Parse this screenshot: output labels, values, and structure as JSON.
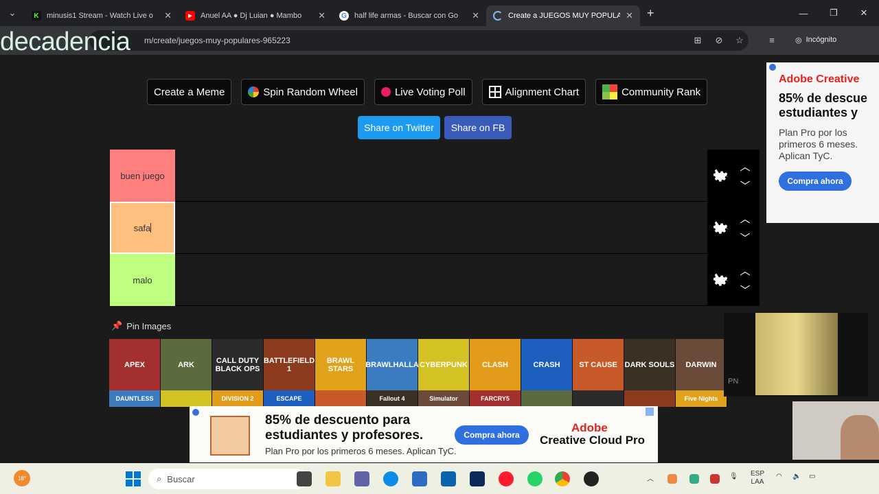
{
  "browser": {
    "tabs": [
      {
        "title": "minusis1 Stream - Watch Live o",
        "favicon": "K",
        "favicon_color": "#53fc18"
      },
      {
        "title": "Anuel AA ● Dj Luian ● Mambo",
        "favicon": "youtube-icon",
        "favicon_color": "#ff0000"
      },
      {
        "title": "half life armas - Buscar con Go",
        "favicon": "G",
        "favicon_color": "#4285f4"
      },
      {
        "title": "Create a JUEGOS MUY POPULA",
        "favicon": "loading-icon",
        "favicon_color": "#8ab4f8"
      }
    ],
    "url_visible": "m/create/juegos-muy-populares-965223",
    "overlay_text": "decadencia",
    "incognito_label": "Incógnito"
  },
  "toolbar": {
    "buttons": [
      "Create a Meme",
      "Spin Random Wheel",
      "Live Voting Poll",
      "Alignment Chart",
      "Community Rank"
    ],
    "share_twitter": "Share on Twitter",
    "share_fb": "Share on FB",
    "twitter_color": "#1d9bf0",
    "fb_color": "#3b5bb8"
  },
  "tiers": [
    {
      "label": "buen juego",
      "color": "#ff7f7f"
    },
    {
      "label": "safa",
      "color": "#ffbf7f"
    },
    {
      "label": "malo",
      "color": "#bfff7f"
    }
  ],
  "pin_images": {
    "title": "Pin Images",
    "row1": [
      "APEX",
      "ARK",
      "CALL DUTY BLACK OPS",
      "BATTLEFIELD 1",
      "BRAWL STARS",
      "BRAWLHALLA",
      "CYBERPUNK",
      "CLASH",
      "CRASH",
      "ST CAUSE",
      "DARK SOULS",
      "DARWIN"
    ],
    "row2": [
      "DAUNTLESS",
      "",
      "DIVISION 2",
      "ESCAPE",
      "",
      "Fallout 4",
      "Simulator",
      "FARCRY5",
      "",
      "",
      "",
      "Five Nights"
    ]
  },
  "ad_right": {
    "brand": "Adobe Creative",
    "headline_1": "85% de descue",
    "headline_2": "estudiantes y",
    "body": "Plan Pro por los primeros 6 meses. Aplican TyC.",
    "cta": "Compra ahora"
  },
  "ad_bottom": {
    "headline_1": "85% de descuento para",
    "headline_2": "estudiantes y profesores.",
    "body": "Plan Pro por los primeros 6 meses. Aplican TyC.",
    "cta": "Compra ahora",
    "brand_1": "Adobe",
    "brand_2": "Creative Cloud Pro"
  },
  "taskbar": {
    "temperature": "18°",
    "search_placeholder": "Buscar",
    "lang_1": "ESP",
    "lang_2": "LAA"
  },
  "webcam_text": "PN"
}
